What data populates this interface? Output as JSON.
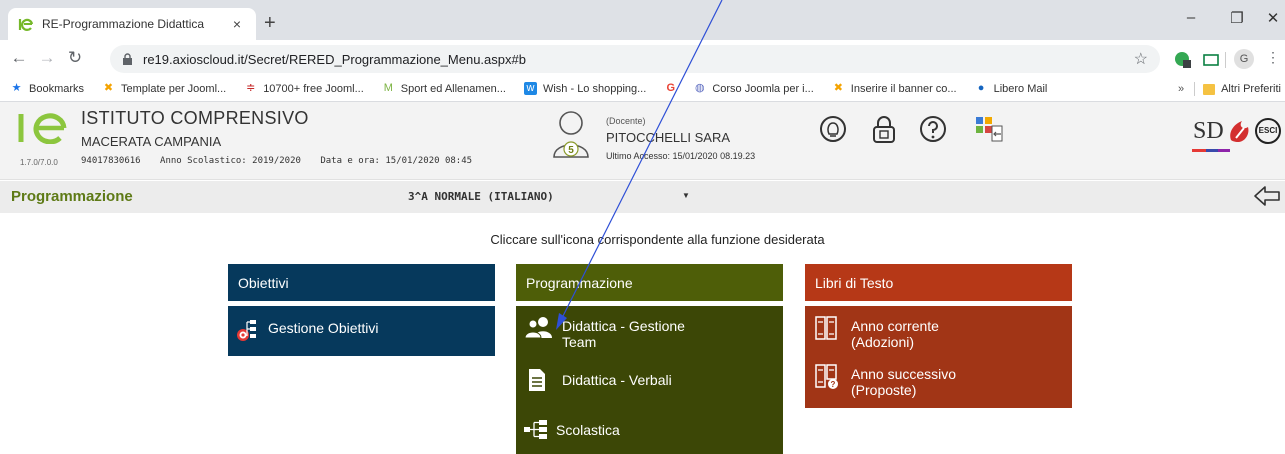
{
  "browser": {
    "tab_title": "RE-Programmazione Didattica",
    "tab_close": "×",
    "new_tab": "+",
    "url": "re19.axioscloud.it/Secret/RERED_Programmazione_Menu.aspx#b",
    "profile_initial": "G",
    "window_controls": [
      "–",
      "❐",
      "✕"
    ]
  },
  "bookmarks": {
    "items": [
      {
        "label": "Bookmarks",
        "icon": "star-icon",
        "color": "#1a73e8"
      },
      {
        "label": "Template per Jooml...",
        "icon": "joomla-icon",
        "color": "#f4a300"
      },
      {
        "label": "10700+ free Jooml...",
        "icon": "flag-icon",
        "color": "#c62828"
      },
      {
        "label": "Sport ed Allenamen...",
        "icon": "sport-icon",
        "color": "#7cb342"
      },
      {
        "label": "Wish - Lo shopping...",
        "icon": "wish-icon",
        "color": "#1e88e5"
      },
      {
        "label": "",
        "icon": "google-icon",
        "color": "#ea4335"
      },
      {
        "label": "Corso Joomla per i...",
        "icon": "joomla-corso-icon",
        "color": "#5c6bc0"
      },
      {
        "label": "Inserire il banner co...",
        "icon": "joomla-icon",
        "color": "#f4a300"
      },
      {
        "label": "Libero Mail",
        "icon": "libero-icon",
        "color": "#1565c0"
      }
    ],
    "more": "»",
    "other_label": "Altri Preferiti"
  },
  "header": {
    "version": "1.7.0/7.0.0",
    "school_name": "ISTITUTO COMPRENSIVO",
    "school_town": "MACERATA CAMPANIA",
    "school_code": "94017830616",
    "school_year": "Anno Scolastico: 2019/2020",
    "datetime": "Data e ora: 15/01/2020 08:45",
    "user_role": "(Docente)",
    "user_name": "PITOCCHELLI SARA",
    "user_badge": "5",
    "last_access": "Ultimo Accesso: 15/01/2020 08.19.23",
    "sd_logo": "SD",
    "exit_label": "ESCI"
  },
  "section": {
    "title": "Programmazione",
    "class_selected": "3^A NORMALE (ITALIANO)",
    "select_arrow": "▼"
  },
  "main": {
    "instruction": "Cliccare sull'icona corrispondente alla funzione desiderata",
    "columns": [
      {
        "title": "Obiettivi",
        "color": "#06395c",
        "items": [
          {
            "label": "Gestione Obiettivi",
            "icon": "goals-target-icon"
          }
        ]
      },
      {
        "title": "Programmazione",
        "color": "#4e5e08",
        "items": [
          {
            "label": "Didattica - Gestione Team",
            "icon": "team-people-icon"
          },
          {
            "label": "Didattica - Verbali",
            "icon": "document-icon"
          },
          {
            "label": "Scolastica",
            "icon": "tree-structure-icon"
          }
        ]
      },
      {
        "title": "Libri di Testo",
        "color": "#b63817",
        "items": [
          {
            "label": "Anno corrente (Adozioni)",
            "icon": "books-icon"
          },
          {
            "label": "Anno successivo (Proposte)",
            "icon": "books-question-icon"
          }
        ]
      }
    ]
  },
  "annotation": {
    "color": "#2e4fd6"
  }
}
